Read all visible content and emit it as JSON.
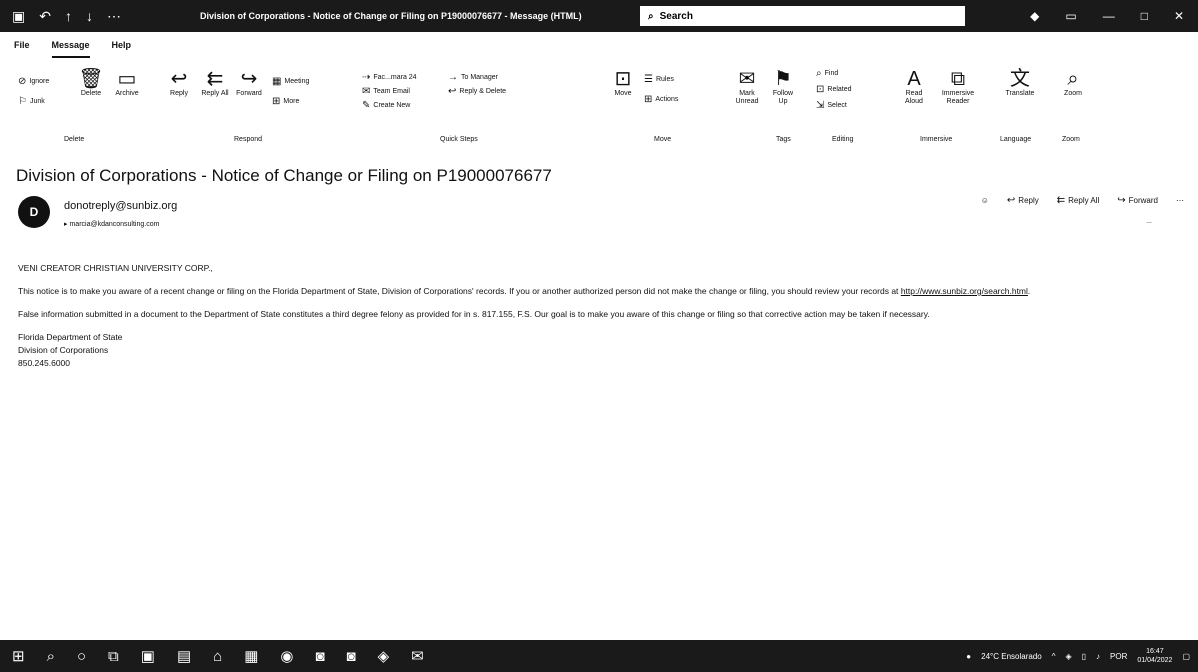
{
  "window": {
    "title": "Division of Corporations - Notice of Change or Filing on P19000076677 - Message (HTML)",
    "search_placeholder": "Search"
  },
  "menu": [
    "File",
    "Message",
    "Help"
  ],
  "ribbon": {
    "delete_group": {
      "ignore": "Ignore",
      "junk": "Junk",
      "delete": "Delete",
      "archive": "Archive",
      "label": "Delete"
    },
    "respond_group": {
      "reply": "Reply",
      "reply_all": "Reply All",
      "forward": "Forward",
      "meeting": "Meeting",
      "more": "More",
      "label": "Respond"
    },
    "quick_steps": {
      "item1": "Fac...mara 24",
      "item2": "Team Email",
      "item3": "Create New",
      "item4": "To Manager",
      "item5": "Reply & Delete",
      "label": "Quick Steps"
    },
    "move_group": {
      "move": "Move",
      "rules": "Rules",
      "actions": "Actions",
      "label": "Move"
    },
    "tags_group": {
      "mark_unread": "Mark Unread",
      "follow_up": "Follow Up",
      "label": "Tags"
    },
    "editing_group": {
      "find": "Find",
      "related": "Related",
      "select": "Select",
      "label": "Editing"
    },
    "immersive_group": {
      "read_aloud": "Read Aloud",
      "immersive_reader": "Immersive Reader",
      "label": "Immersive"
    },
    "language_group": {
      "translate": "Translate",
      "label": "Language"
    },
    "zoom_group": {
      "zoom": "Zoom",
      "label": "Zoom"
    }
  },
  "message": {
    "subject": "Division of Corporations - Notice of Change or Filing on P19000076677",
    "avatar_initial": "D",
    "sender": "donotreply@sunbiz.org",
    "recipient": "marcia@kdanconsulting.com",
    "actions": {
      "reply": "Reply",
      "reply_all": "Reply All",
      "forward": "Forward"
    },
    "time": "...",
    "body": {
      "salutation": "VENI CREATOR CHRISTIAN UNIVERSITY CORP.,",
      "para1": "This notice is to make you aware of a recent change or filing on the Florida Department of State, Division of Corporations' records. If you or another authorized person did not make the change or filing, you should review your records at",
      "link": "http://www.sunbiz.org/search.html",
      "para2": "False information submitted in a document to the Department of State constitutes a third degree felony as provided for in s. 817.155, F.S. Our goal is to make you aware of this change or filing so that corrective action may be taken if necessary.",
      "sig1": "Florida Department of State",
      "sig2": "Division of Corporations",
      "sig3": "850.245.6000"
    }
  },
  "taskbar": {
    "weather": "24°C  Ensolarado",
    "lang": "POR",
    "time": "16:47",
    "date": "01/04/2022"
  }
}
